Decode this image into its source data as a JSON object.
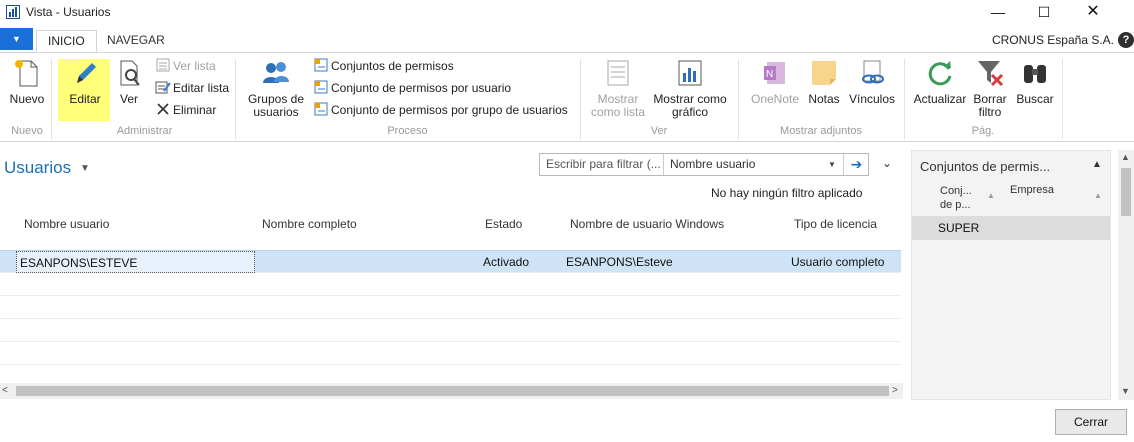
{
  "window": {
    "title": "Vista - Usuarios",
    "minimize_glyph": "—",
    "maximize_glyph": "☐",
    "close_glyph": "✕"
  },
  "tabs": {
    "file_glyph": "▼",
    "items": [
      "INICIO",
      "NAVEGAR"
    ],
    "company": "CRONUS España S.A.",
    "help_glyph": "?"
  },
  "ribbon": {
    "groups": {
      "nuevo": "Nuevo",
      "administrar": "Administrar",
      "proceso": "Proceso",
      "ver": "Ver",
      "adjuntos": "Mostrar adjuntos",
      "pag": "Pág."
    },
    "nuevo": {
      "label": "Nuevo",
      "icon": "new-document-icon"
    },
    "editar": {
      "label": "Editar",
      "icon": "pencil-icon"
    },
    "ver": {
      "label": "Ver",
      "icon": "magnifier-document-icon"
    },
    "ver_lista": {
      "label": "Ver lista",
      "icon": "list-view-icon"
    },
    "editar_lista": {
      "label": "Editar lista",
      "icon": "edit-list-icon"
    },
    "eliminar": {
      "label": "Eliminar",
      "icon": "delete-x-icon"
    },
    "grupos": {
      "line1": "Grupos de",
      "line2": "usuarios",
      "icon": "user-group-icon"
    },
    "conjuntos_permisos": {
      "label": "Conjuntos de permisos",
      "icon": "permission-set-icon"
    },
    "permisos_usuario": {
      "label": "Conjunto de permisos por usuario",
      "icon": "permission-set-icon"
    },
    "permisos_grupo": {
      "label": "Conjunto de permisos por grupo de usuarios",
      "icon": "permission-set-icon"
    },
    "mostrar_lista": {
      "line1": "Mostrar",
      "line2": "como lista",
      "icon": "show-list-icon"
    },
    "mostrar_grafico": {
      "line1": "Mostrar como",
      "line2": "gráfico",
      "icon": "chart-icon"
    },
    "onenote": {
      "label": "OneNote",
      "icon": "onenote-icon"
    },
    "notas": {
      "label": "Notas",
      "icon": "notes-icon"
    },
    "vinculos": {
      "label": "Vínculos",
      "icon": "link-icon"
    },
    "actualizar": {
      "label": "Actualizar",
      "icon": "refresh-icon"
    },
    "borrar_filtro": {
      "line1": "Borrar",
      "line2": "filtro",
      "icon": "clear-filter-icon"
    },
    "buscar": {
      "label": "Buscar",
      "icon": "binoculars-icon"
    }
  },
  "list": {
    "title": "Usuarios",
    "title_caret": "▼",
    "filter_placeholder": "Escribir para filtrar (...",
    "filter_field": "Nombre usuario",
    "filter_caret": "▼",
    "filter_go": "➔",
    "expand_caret": "⌄",
    "no_filter": "No hay ningún filtro aplicado",
    "columns": [
      "Nombre usuario",
      "Nombre completo",
      "Estado",
      "Nombre de usuario Windows",
      "Tipo de licencia"
    ],
    "rows": [
      {
        "nombre_usuario": "ESANPONS\\ESTEVE",
        "nombre_completo": "",
        "estado": "Activado",
        "usuario_windows": "ESANPONS\\Esteve",
        "tipo_licencia": "Usuario completo"
      }
    ],
    "scroll_left": "<",
    "scroll_right": ">"
  },
  "factbox": {
    "title": "Conjuntos de permis...",
    "collapse_glyph": "▲",
    "col1_line1": "Conj...",
    "col1_line2": "de p...",
    "col2": "Empresa",
    "sort_glyph": "▲",
    "rows": [
      "SUPER"
    ]
  },
  "vscroll": {
    "up": "▲",
    "down": "▼"
  },
  "footer": {
    "close_label": "Cerrar"
  },
  "colors": {
    "accent_blue": "#1a6fb8",
    "file_tab_blue": "#1a6fd8",
    "selected_row": "#cfe3f7",
    "editar_highlight": "#ffff7a"
  }
}
